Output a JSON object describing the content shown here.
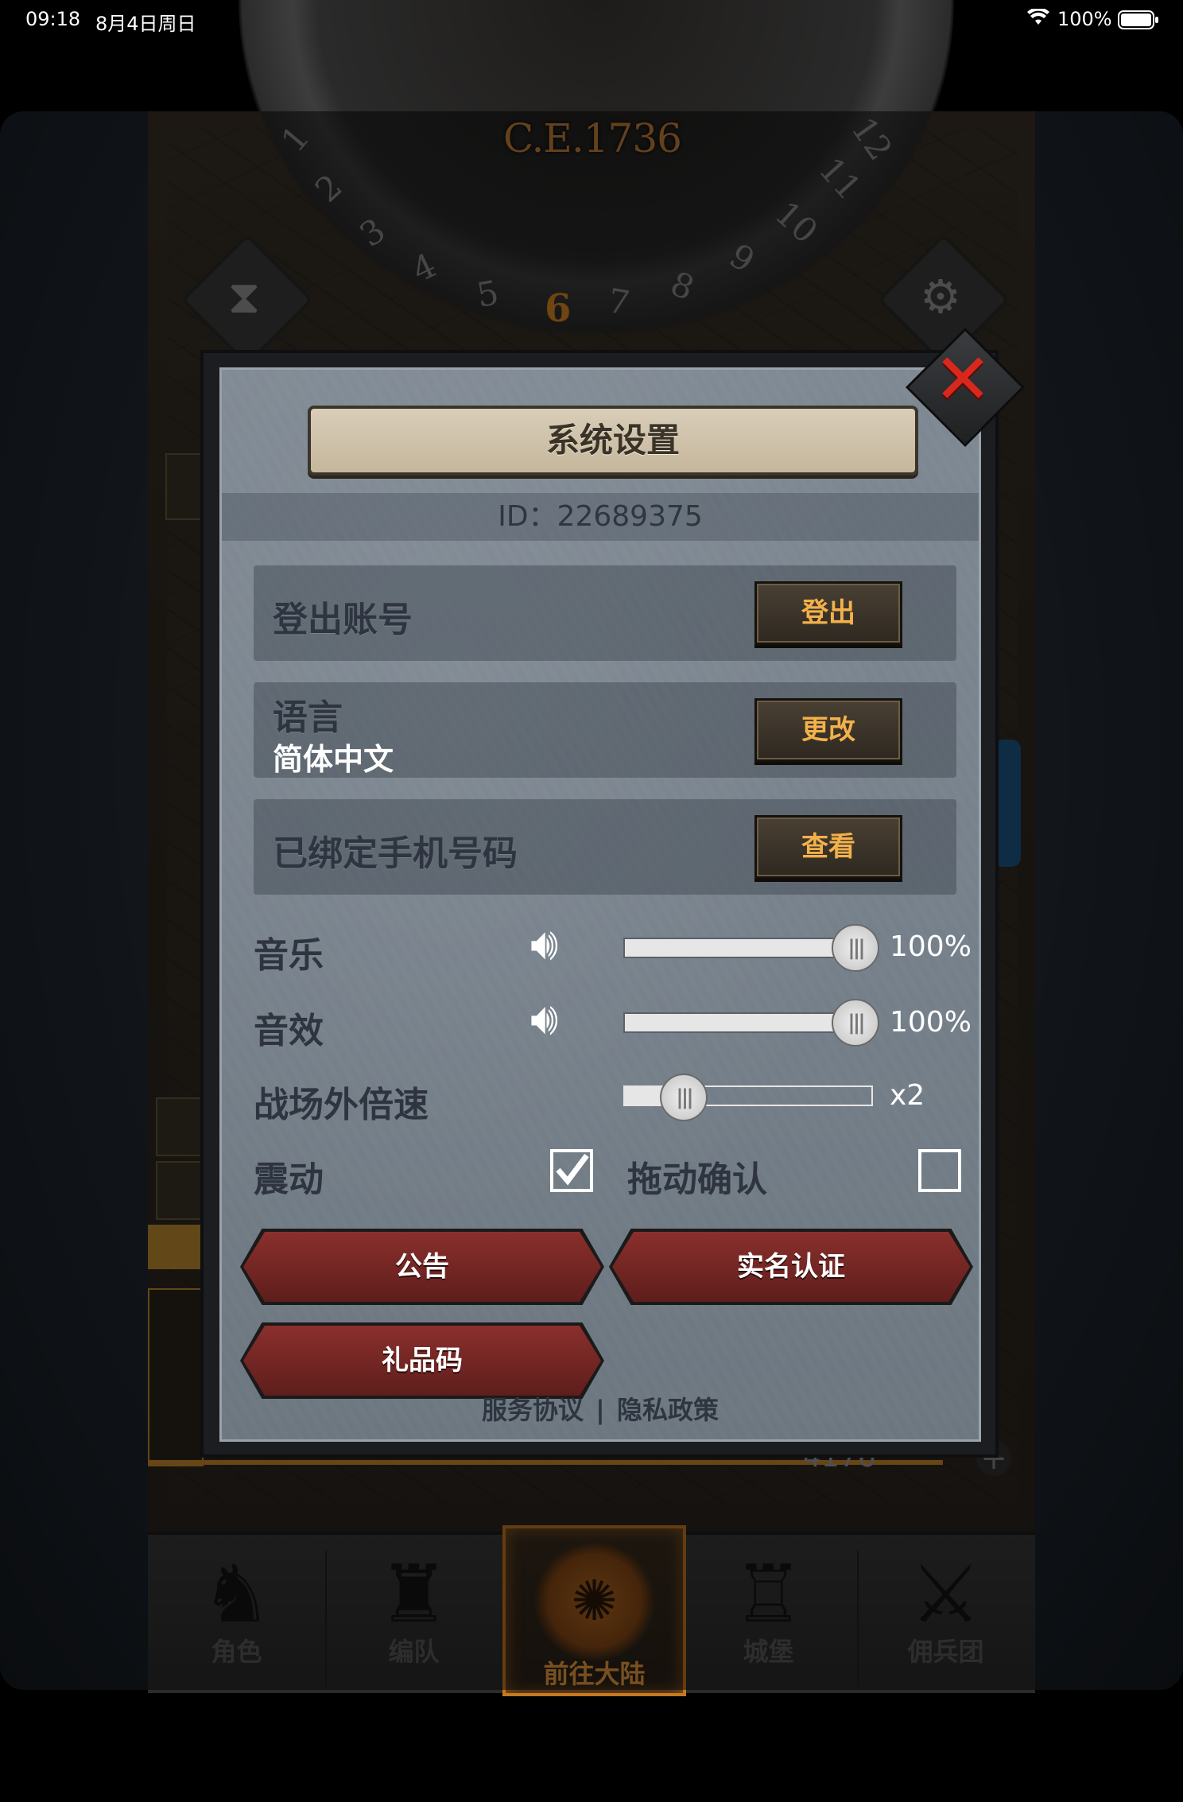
{
  "status_bar": {
    "time": "09:18",
    "date": "8月4日周日",
    "battery": "100%",
    "wifi_icon": "wifi-icon",
    "battery_icon": "battery-icon"
  },
  "game": {
    "year": "C.E.1736",
    "dial_numbers": [
      "1",
      "2",
      "3",
      "4",
      "5",
      "6",
      "7",
      "8",
      "9",
      "10",
      "11",
      "12"
    ],
    "current_month": "6",
    "resource_count": "4176"
  },
  "dialog": {
    "title": "系统设置",
    "id_text": "ID：22689375",
    "logout": {
      "label": "登出账号",
      "button": "登出"
    },
    "language": {
      "label": "语言",
      "value": "简体中文",
      "button": "更改"
    },
    "phone": {
      "label": "已绑定手机号码",
      "button": "查看"
    },
    "music": {
      "label": "音乐",
      "percent": "100%",
      "level": 1.0
    },
    "sfx": {
      "label": "音效",
      "percent": "100%",
      "level": 1.0
    },
    "speed": {
      "label": "战场外倍速",
      "value": "x2",
      "level": 0.2
    },
    "vibration": {
      "label": "震动",
      "checked": true
    },
    "drag_confirm": {
      "label": "拖动确认",
      "checked": false
    },
    "buttons": {
      "announcement": "公告",
      "real_name": "实名认证",
      "gift_code": "礼品码"
    },
    "footer": {
      "terms": "服务协议",
      "separator": "|",
      "privacy": "隐私政策"
    }
  },
  "bottom_nav": [
    {
      "label": "角色",
      "icon": "knight-icon"
    },
    {
      "label": "编队",
      "icon": "helmet-icon"
    },
    {
      "label": "前往大陆",
      "icon": "compass-icon",
      "active": true
    },
    {
      "label": "城堡",
      "icon": "castle-icon"
    },
    {
      "label": "佣兵团",
      "icon": "mercenary-icon"
    }
  ],
  "colors": {
    "accent_gold": "#f2b14a",
    "close_red": "#d8281e",
    "panel_gray": "#7f8993",
    "nav_active": "#c8781e"
  }
}
